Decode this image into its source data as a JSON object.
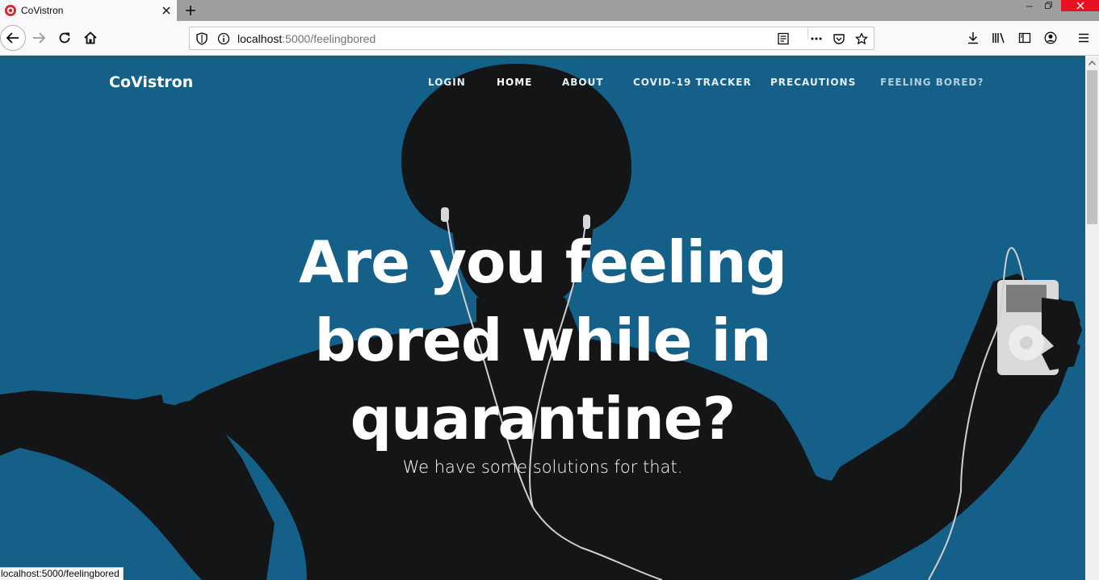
{
  "browser": {
    "tab_title": "CoVistron",
    "url_host": "localhost",
    "url_rest": ":5000/feelingbored",
    "status_url": "localhost:5000/feelingbored"
  },
  "icons": {
    "favicon": "covistron-logo-icon",
    "tab_close": "close-icon",
    "new_tab": "plus-icon",
    "back": "arrow-left-icon",
    "forward": "arrow-right-icon",
    "reload": "reload-icon",
    "home": "home-icon",
    "tracking_protection": "shield-icon",
    "site_info": "info-icon",
    "reader_view": "reader-view-icon",
    "page_actions": "ellipsis-icon",
    "pocket": "pocket-icon",
    "bookmark": "star-icon",
    "downloads": "download-icon",
    "library": "library-icon",
    "sidebar": "sidebar-icon",
    "account": "account-icon",
    "menu": "hamburger-menu-icon"
  },
  "site": {
    "brand": "CoVistron",
    "nav": [
      {
        "label": "LOGIN"
      },
      {
        "label": "HOME"
      },
      {
        "label": "ABOUT"
      },
      {
        "label": "COVID-19 TRACKER"
      },
      {
        "label": "PRECAUTIONS"
      },
      {
        "label": "FEELING BORED?"
      }
    ]
  },
  "hero": {
    "headline_line1": "Are you feeling",
    "headline_line2": "bored while in",
    "headline_line3": "quarantine?",
    "subheadline": "We have some solutions for that."
  },
  "colors": {
    "hero_background": "#156089",
    "silhouette": "#141517",
    "accent_close": "#e81123"
  }
}
